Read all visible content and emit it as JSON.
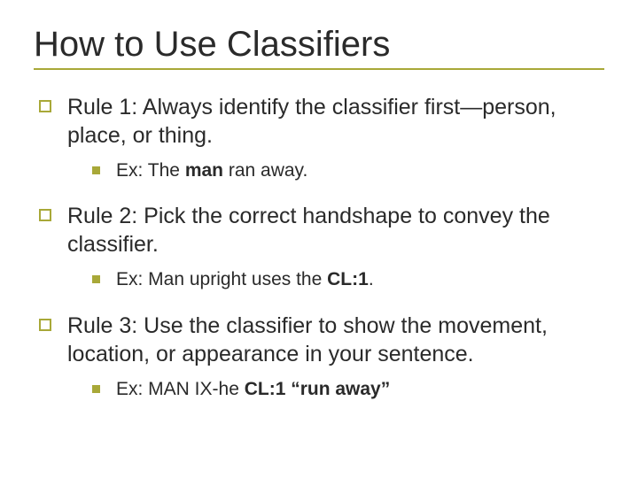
{
  "title": "How to Use Classifiers",
  "rules": [
    {
      "text": "Rule 1: Always identify the classifier first—person, place, or thing.",
      "ex_pre": "Ex: The ",
      "ex_bold": "man",
      "ex_post": " ran away."
    },
    {
      "text": "Rule 2: Pick the correct handshape to convey the classifier.",
      "ex_pre": "Ex: Man upright uses the ",
      "ex_bold": "CL:1",
      "ex_post": "."
    },
    {
      "text": "Rule 3: Use the classifier to show the movement, location, or appearance in your sentence.",
      "ex_pre": "Ex: MAN IX-he ",
      "ex_bold": "CL:1 “run away”",
      "ex_post": ""
    }
  ]
}
